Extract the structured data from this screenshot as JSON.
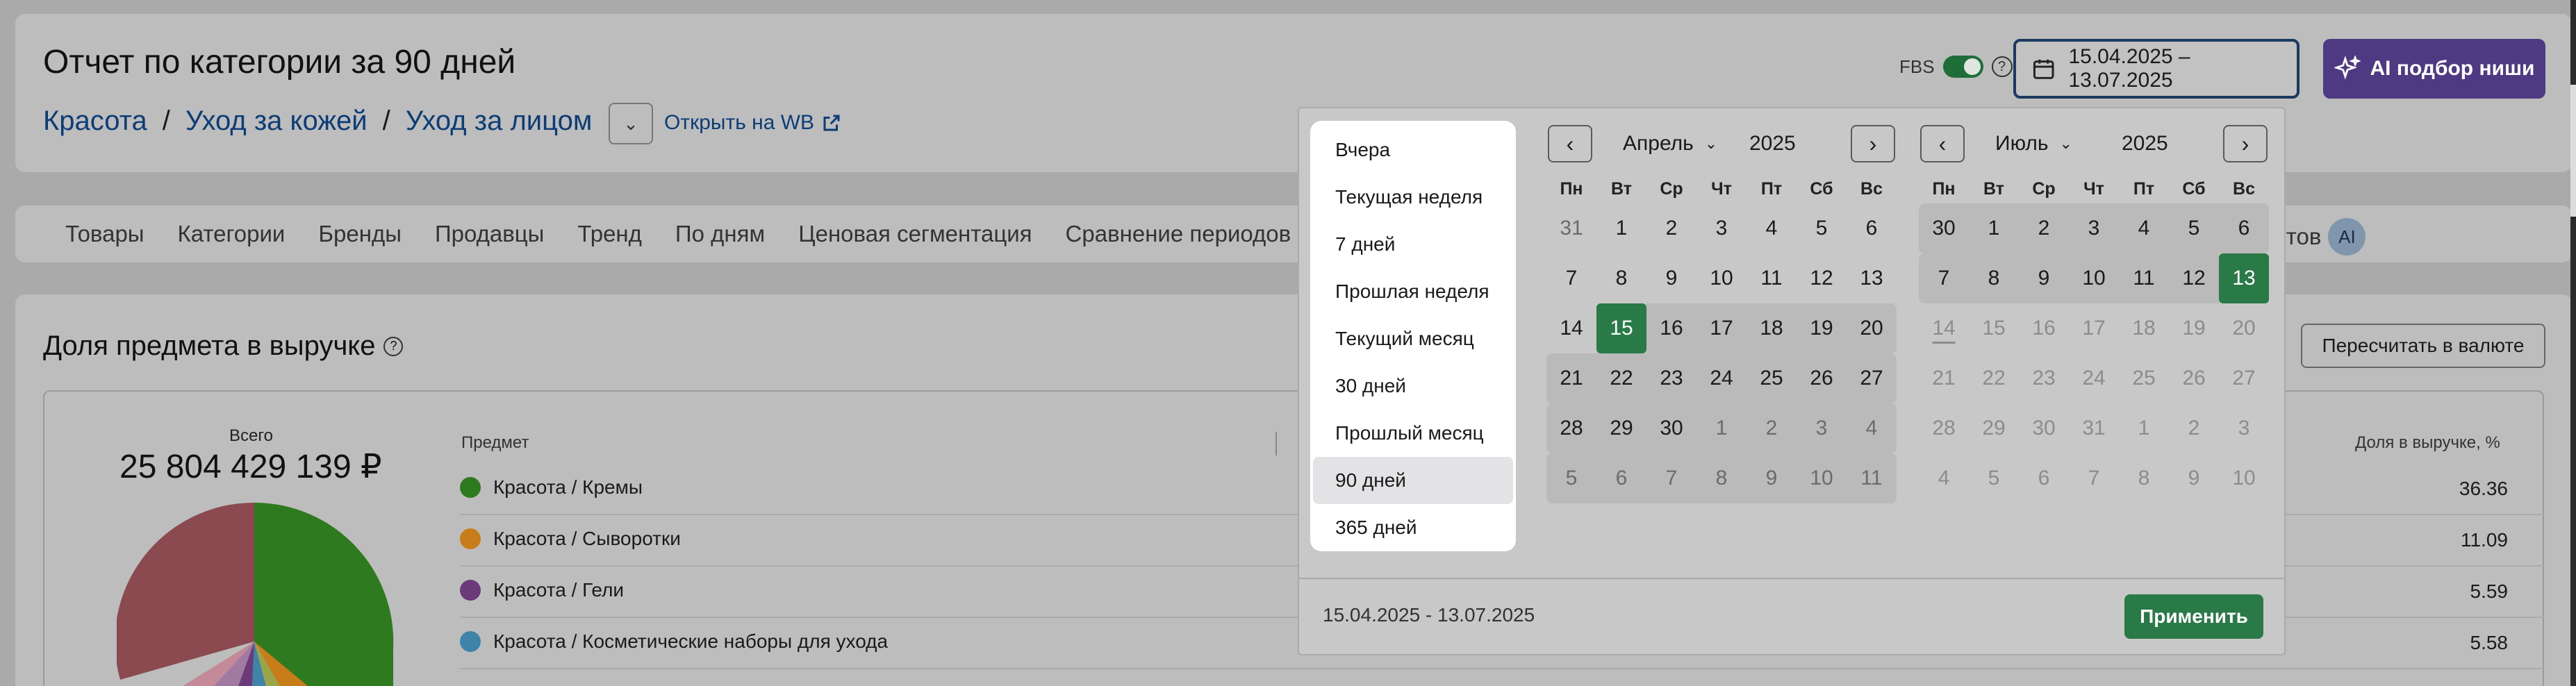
{
  "header": {
    "title": "Отчет по категории за 90 дней",
    "breadcrumbs": [
      "Красота",
      "Уход за кожей",
      "Уход за лицом"
    ],
    "separator": "/",
    "open_wb": "Открыть на WB",
    "fbs_label": "FBS",
    "fbs_on": true,
    "date_range": "15.04.2025 – 13.07.2025",
    "ai_button": "AI подбор ниши"
  },
  "tabs": [
    "Товары",
    "Категории",
    "Бренды",
    "Продавцы",
    "Тренд",
    "По дням",
    "Ценовая сегментация",
    "Сравнение периодов"
  ],
  "tab_partial": "ктов",
  "tab_ai_badge": "AI",
  "section": {
    "title": "Доля предмета в выручке",
    "recalc_button": "Пересчитать в валюте",
    "total_label": "Всего",
    "total_value": "25 804 429 139 ₽",
    "col_subject": "Предмет",
    "col_share": "Доля в выручке, %",
    "rows": [
      {
        "name": "Красота / Кремы",
        "share": "36.36",
        "color": "#2e7a1e"
      },
      {
        "name": "Красота / Сыворотки",
        "share": "11.09",
        "color": "#c97d1a"
      },
      {
        "name": "Красота / Гели",
        "share": "5.59",
        "color": "#6b3a78"
      },
      {
        "name": "Красота / Косметические наборы для ухода",
        "share": "5.58",
        "color": "#3d84a8"
      }
    ]
  },
  "datepicker": {
    "presets": [
      "Вчера",
      "Текущая неделя",
      "7 дней",
      "Прошлая неделя",
      "Текущий месяц",
      "30 дней",
      "Прошлый месяц",
      "90 дней",
      "365 дней"
    ],
    "active_preset": "90 дней",
    "weekdays": [
      "Пн",
      "Вт",
      "Ср",
      "Чт",
      "Пт",
      "Сб",
      "Вс"
    ],
    "left": {
      "month": "Апрель",
      "year": "2025",
      "days": [
        "31",
        "1",
        "2",
        "3",
        "4",
        "5",
        "6",
        "7",
        "8",
        "9",
        "10",
        "11",
        "12",
        "13",
        "14",
        "15",
        "16",
        "17",
        "18",
        "19",
        "20",
        "21",
        "22",
        "23",
        "24",
        "25",
        "26",
        "27",
        "28",
        "29",
        "30",
        "1",
        "2",
        "3",
        "4",
        "5",
        "6",
        "7",
        "8",
        "9",
        "10",
        "11"
      ]
    },
    "right": {
      "month": "Июль",
      "year": "2025",
      "days": [
        "30",
        "1",
        "2",
        "3",
        "4",
        "5",
        "6",
        "7",
        "8",
        "9",
        "10",
        "11",
        "12",
        "13",
        "14",
        "15",
        "16",
        "17",
        "18",
        "19",
        "20",
        "21",
        "22",
        "23",
        "24",
        "25",
        "26",
        "27",
        "28",
        "29",
        "30",
        "31",
        "1",
        "2",
        "3",
        "4",
        "5",
        "6",
        "7",
        "8",
        "9",
        "10"
      ]
    },
    "range_text": "15.04.2025 - 13.07.2025",
    "apply_button": "Применить"
  }
}
